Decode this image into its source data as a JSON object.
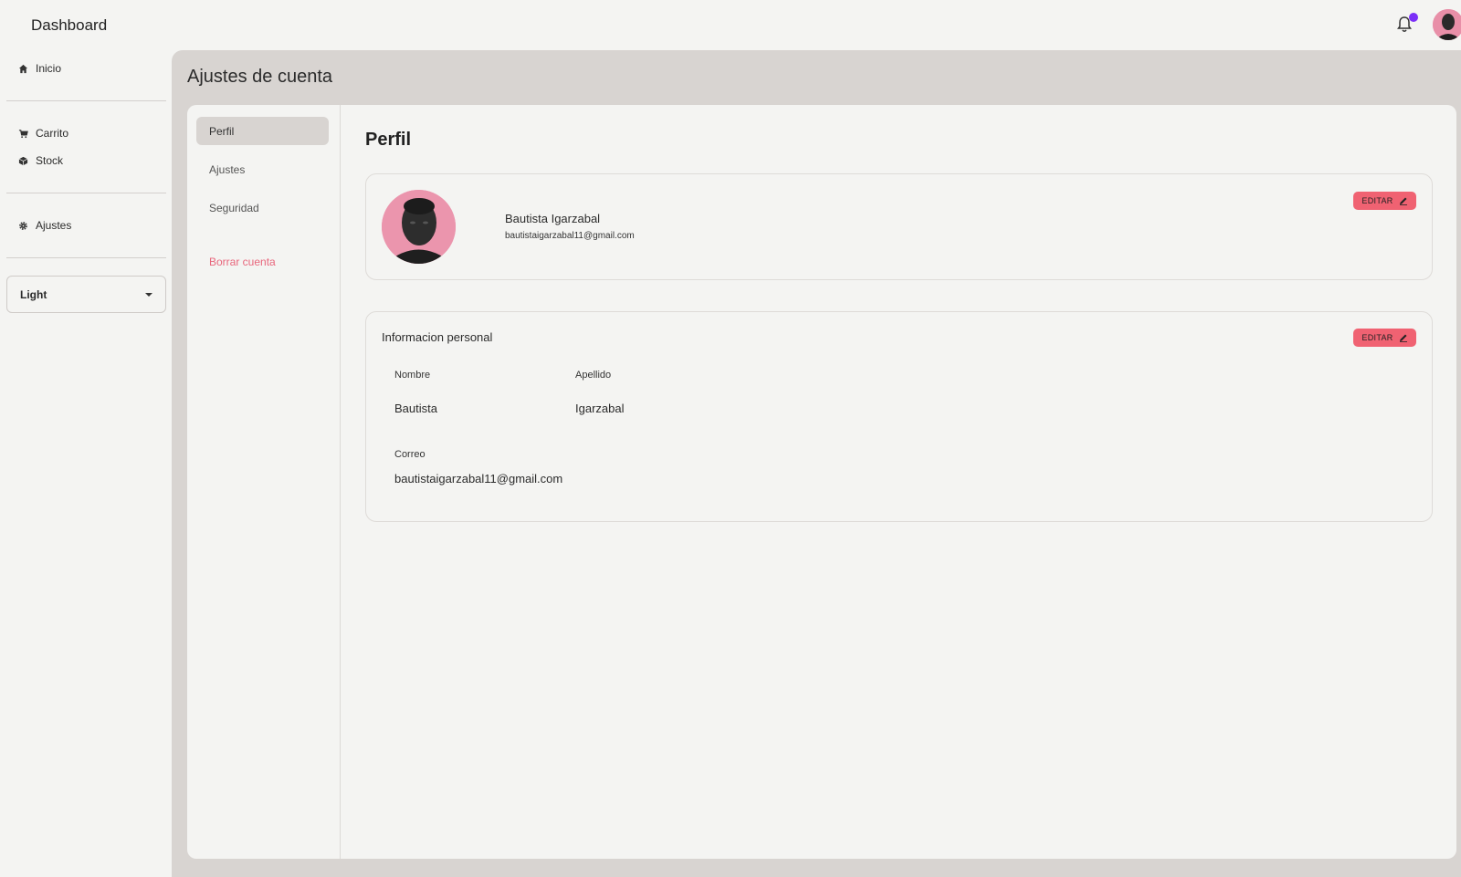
{
  "app": {
    "title": "Dashboard"
  },
  "sidebar": {
    "items": [
      {
        "label": "Inicio",
        "icon": "home-icon"
      },
      {
        "label": "Carrito",
        "icon": "cart-icon"
      },
      {
        "label": "Stock",
        "icon": "box-icon"
      },
      {
        "label": "Ajustes",
        "icon": "gear-icon"
      }
    ],
    "theme": {
      "selected": "Light"
    }
  },
  "header": {
    "page_title": "Ajustes de cuenta",
    "notification_dot_color": "#7b2ff7"
  },
  "subnav": {
    "items": [
      {
        "label": "Perfil",
        "active": true
      },
      {
        "label": "Ajustes"
      },
      {
        "label": "Seguridad"
      }
    ],
    "danger": {
      "label": "Borrar cuenta"
    }
  },
  "profile": {
    "section_title": "Perfil",
    "name": "Bautista Igarzabal",
    "email": "bautistaigarzabal11@gmail.com",
    "edit_label": "EDITAR"
  },
  "personal_info": {
    "title": "Informacion personal",
    "edit_label": "EDITAR",
    "first_name_label": "Nombre",
    "first_name": "Bautista",
    "last_name_label": "Apellido",
    "last_name": "Igarzabal",
    "email_label": "Correo",
    "email": "bautistaigarzabal11@gmail.com"
  },
  "colors": {
    "accent": "#f06272",
    "danger_text": "#e8677d",
    "panel_bg": "#d8d4d1"
  }
}
